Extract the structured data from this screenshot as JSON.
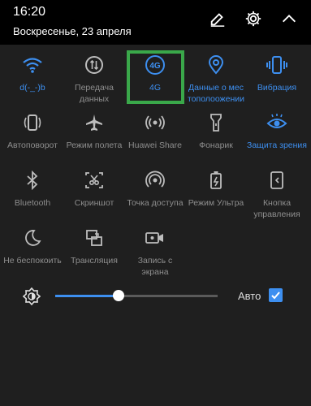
{
  "status": {
    "time": "16:20",
    "date": "Воскресенье, 23 апреля"
  },
  "top_actions": {
    "edit_icon": "pencil-icon",
    "settings_icon": "gear-icon",
    "collapse_icon": "chevron-up-icon"
  },
  "tiles": [
    {
      "id": "wifi",
      "label": "d(-_-)b",
      "icon": "wifi-icon",
      "active": true
    },
    {
      "id": "data-transfer",
      "label": "Передача данных",
      "icon": "data-transfer-icon",
      "active": false
    },
    {
      "id": "4g",
      "label": "4G",
      "icon": "4g-icon",
      "active": true
    },
    {
      "id": "location",
      "label": "Данные о мес тополоожении",
      "icon": "location-pin-icon",
      "active": true
    },
    {
      "id": "vibration",
      "label": "Вибрация",
      "icon": "vibration-icon",
      "active": true
    },
    {
      "id": "autorotate",
      "label": "Автоповорот",
      "icon": "autorotate-icon",
      "active": false
    },
    {
      "id": "airplane",
      "label": "Режим полета",
      "icon": "airplane-icon",
      "active": false
    },
    {
      "id": "huawei-share",
      "label": "Huawei Share",
      "icon": "huawei-share-icon",
      "active": false
    },
    {
      "id": "flashlight",
      "label": "Фонарик",
      "icon": "flashlight-icon",
      "active": false
    },
    {
      "id": "eye-comfort",
      "label": "Защита зрения",
      "icon": "eye-icon",
      "active": true
    },
    {
      "id": "bluetooth",
      "label": "Bluetooth",
      "icon": "bluetooth-icon",
      "active": false
    },
    {
      "id": "screenshot",
      "label": "Скриншот",
      "icon": "screenshot-icon",
      "active": false
    },
    {
      "id": "hotspot",
      "label": "Точка доступа",
      "icon": "hotspot-icon",
      "active": false
    },
    {
      "id": "ultra",
      "label": "Режим Ультра",
      "icon": "battery-icon",
      "active": false
    },
    {
      "id": "nav-keys",
      "label": "Кнопка управления",
      "icon": "nav-button-icon",
      "active": false
    },
    {
      "id": "dnd",
      "label": "Не беспокоить",
      "icon": "moon-icon",
      "active": false
    },
    {
      "id": "cast",
      "label": "Трансляция",
      "icon": "cast-icon",
      "active": false
    },
    {
      "id": "screen-record",
      "label": "Запись с экрана",
      "icon": "screen-record-icon",
      "active": false
    }
  ],
  "brightness": {
    "icon": "brightness-icon",
    "level": 0.39,
    "auto_label": "Авто",
    "auto_checked": true
  },
  "colors": {
    "accent": "#3d8ff0",
    "inactive": "#8e8e8e",
    "highlight": "#3aa84a",
    "panel": "#1f1f1f"
  }
}
